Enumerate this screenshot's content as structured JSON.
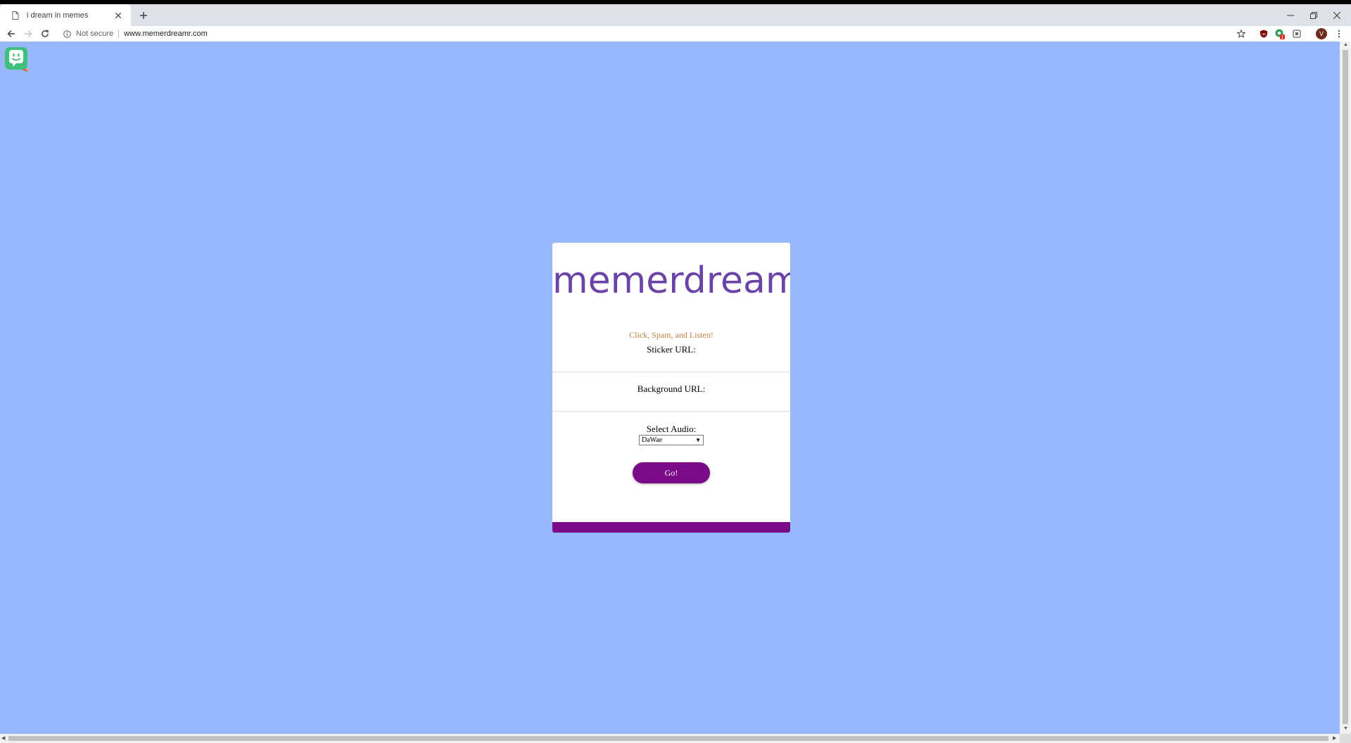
{
  "browser": {
    "tab_title": "i dream in memes",
    "security_label": "Not secure",
    "url": "www.memerdreamr.com",
    "profile_initial": "V",
    "extension_badge": "1"
  },
  "page": {
    "logo": "memerdreamr",
    "tagline": "Click, Spam, and Listen!",
    "sticker_label": "Sticker URL:",
    "background_label": "Background URL:",
    "audio_label": "Select Audio:",
    "audio_selected": "DaWae",
    "go_label": "Go!"
  },
  "colors": {
    "page_background": "#97b9fb",
    "accent_purple": "#7a0a87",
    "logo_purple": "#6a44a6",
    "tagline_gold": "#bb8344"
  }
}
